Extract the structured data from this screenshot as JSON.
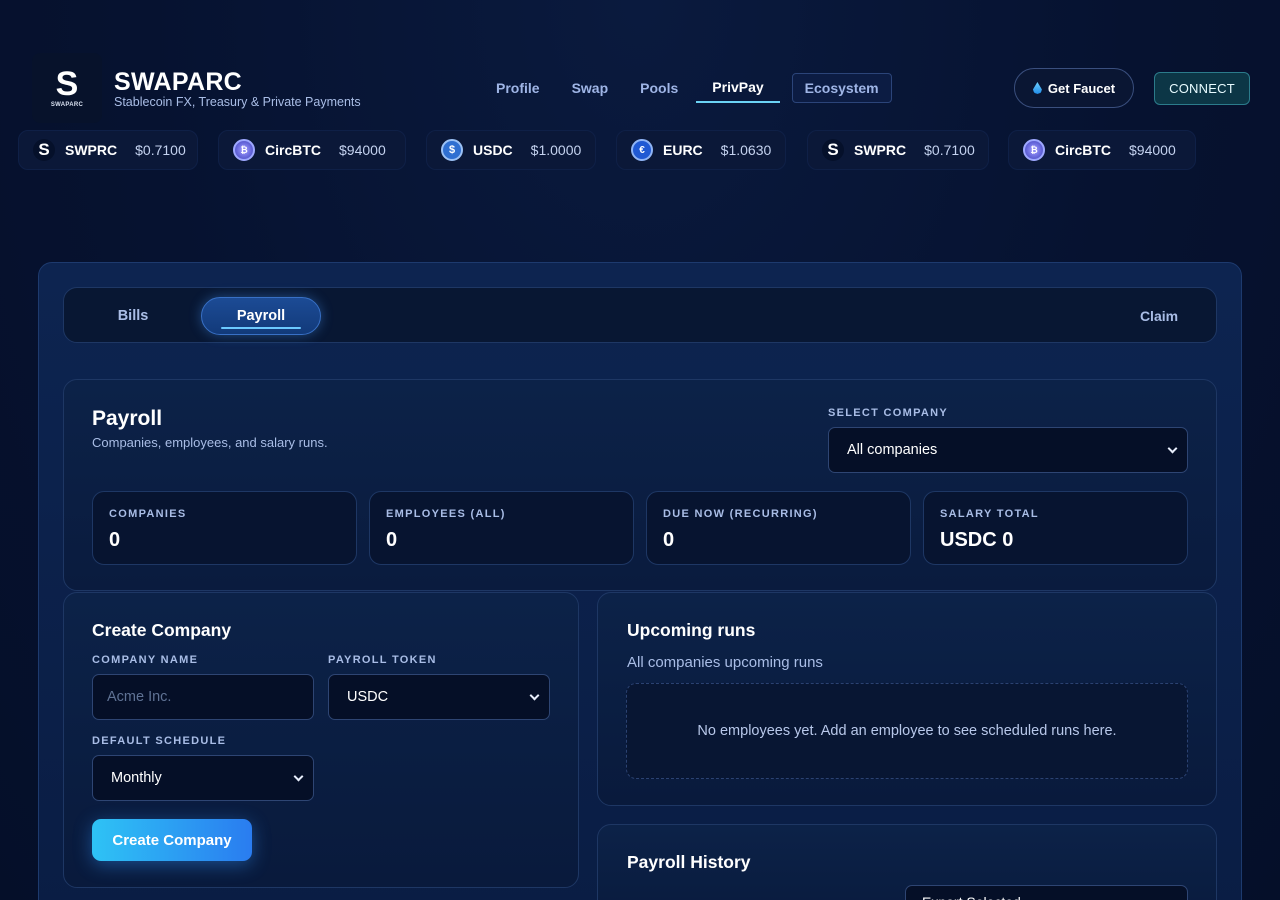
{
  "brand": {
    "logo_letter": "S",
    "logo_text": "SWAPARC",
    "title": "SWAPARC",
    "subtitle": "Stablecoin FX, Treasury & Private Payments"
  },
  "nav": {
    "items": [
      {
        "label": "Profile"
      },
      {
        "label": "Swap"
      },
      {
        "label": "Pools"
      },
      {
        "label": "PrivPay",
        "active": true
      },
      {
        "label": "Ecosystem"
      }
    ]
  },
  "header_actions": {
    "faucet_label": "Get Faucet",
    "connect_label": "CONNECT"
  },
  "ticker": [
    {
      "symbol": "SWPRC",
      "price": "$0.7100",
      "icon": "swaparc-icon"
    },
    {
      "symbol": "CircBTC",
      "price": "$94000",
      "icon": "bitcoin-icon"
    },
    {
      "symbol": "USDC",
      "price": "$1.0000",
      "icon": "usdc-icon"
    },
    {
      "symbol": "EURC",
      "price": "$1.0630",
      "icon": "eurc-icon"
    },
    {
      "symbol": "SWPRC",
      "price": "$0.7100",
      "icon": "swaparc-icon"
    },
    {
      "symbol": "CircBTC",
      "price": "$94000",
      "icon": "bitcoin-icon"
    }
  ],
  "tabs": {
    "bills": "Bills",
    "payroll": "Payroll",
    "claim": "Claim",
    "active": "Payroll"
  },
  "summary": {
    "title": "Payroll",
    "subtitle": "Companies, employees, and salary runs.",
    "select_company_label": "SELECT COMPANY",
    "select_company_value": "All companies",
    "stats": [
      {
        "label": "COMPANIES",
        "value": "0"
      },
      {
        "label": "EMPLOYEES (ALL)",
        "value": "0"
      },
      {
        "label": "DUE NOW (RECURRING)",
        "value": "0"
      },
      {
        "label": "SALARY TOTAL",
        "value": "USDC 0"
      }
    ]
  },
  "create_company": {
    "title": "Create Company",
    "company_name_label": "COMPANY NAME",
    "company_name_placeholder": "Acme Inc.",
    "payroll_token_label": "PAYROLL TOKEN",
    "payroll_token_value": "USDC",
    "default_schedule_label": "DEFAULT SCHEDULE",
    "default_schedule_value": "Monthly",
    "button_label": "Create Company"
  },
  "upcoming": {
    "title": "Upcoming runs",
    "subtitle": "All companies upcoming runs",
    "empty_text": "No employees yet. Add an employee to see scheduled runs here."
  },
  "history": {
    "title": "Payroll History",
    "select_value": "Export Selected"
  },
  "colors": {
    "background": "#061230",
    "accent": "#6bd3f5",
    "primary_button_start": "#2ec3f5",
    "primary_button_end": "#2a7cf0"
  }
}
